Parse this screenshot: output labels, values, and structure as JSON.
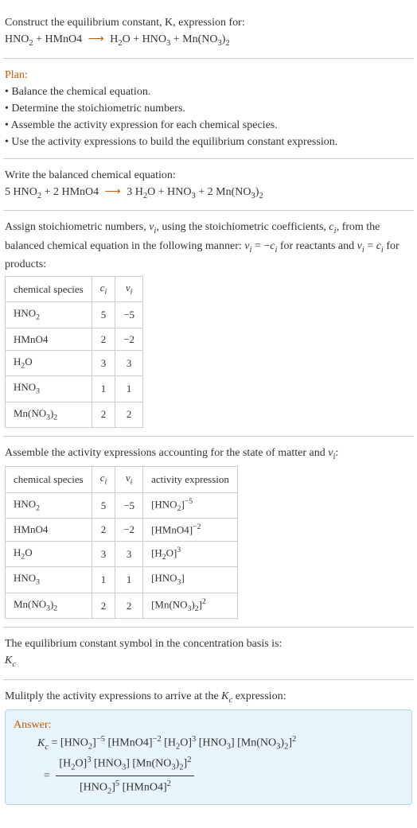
{
  "intro": {
    "heading": "Construct the equilibrium constant, K, expression for:",
    "equation_lhs": "HNO₂ + HMnO4",
    "equation_arrow": "⟶",
    "equation_rhs": "H₂O + HNO₃ + Mn(NO₃)₂"
  },
  "plan": {
    "heading": "Plan:",
    "steps": [
      "• Balance the chemical equation.",
      "• Determine the stoichiometric numbers.",
      "• Assemble the activity expression for each chemical species.",
      "• Use the activity expressions to build the equilibrium constant expression."
    ]
  },
  "balanced": {
    "heading": "Write the balanced chemical equation:",
    "equation_lhs": "5 HNO₂ + 2 HMnO4",
    "equation_arrow": "⟶",
    "equation_rhs": "3 H₂O + HNO₃ + 2 Mn(NO₃)₂"
  },
  "stoich": {
    "heading_a": "Assign stoichiometric numbers, νᵢ, using the stoichiometric coefficients, cᵢ, from the balanced chemical equation in the following manner: ",
    "heading_b": "νᵢ = −cᵢ for reactants and νᵢ = cᵢ for products:",
    "table": {
      "headers": [
        "chemical species",
        "cᵢ",
        "νᵢ"
      ],
      "rows": [
        [
          "HNO₂",
          "5",
          "−5"
        ],
        [
          "HMnO4",
          "2",
          "−2"
        ],
        [
          "H₂O",
          "3",
          "3"
        ],
        [
          "HNO₃",
          "1",
          "1"
        ],
        [
          "Mn(NO₃)₂",
          "2",
          "2"
        ]
      ]
    }
  },
  "activity": {
    "heading": "Assemble the activity expressions accounting for the state of matter and νᵢ:",
    "table": {
      "headers": [
        "chemical species",
        "cᵢ",
        "νᵢ",
        "activity expression"
      ],
      "rows": [
        [
          "HNO₂",
          "5",
          "−5",
          "[HNO₂]⁻⁵"
        ],
        [
          "HMnO4",
          "2",
          "−2",
          "[HMnO4]⁻²"
        ],
        [
          "H₂O",
          "3",
          "3",
          "[H₂O]³"
        ],
        [
          "HNO₃",
          "1",
          "1",
          "[HNO₃]"
        ],
        [
          "Mn(NO₃)₂",
          "2",
          "2",
          "[Mn(NO₃)₂]²"
        ]
      ]
    }
  },
  "symbol": {
    "heading": "The equilibrium constant symbol in the concentration basis is:",
    "value": "K𞁞"
  },
  "final": {
    "heading": "Mulitply the activity expressions to arrive at the K𞁞 expression:",
    "answer_label": "Answer:",
    "expr_line1_lhs": "K𞁞 = ",
    "expr_line1_rhs": "[HNO₂]⁻⁵ [HMnO4]⁻² [H₂O]³ [HNO₃] [Mn(NO₃)₂]²",
    "eq_sign": "= ",
    "frac_num": "[H₂O]³ [HNO₃] [Mn(NO₃)₂]²",
    "frac_den": "[HNO₂]⁵ [HMnO4]²"
  }
}
